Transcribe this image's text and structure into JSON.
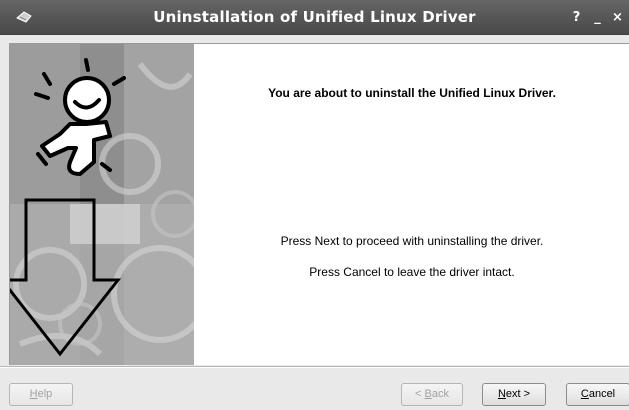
{
  "window": {
    "title": "Uninstallation of Unified Linux Driver",
    "title_buttons": {
      "help": "?",
      "minimize": "_",
      "close": "×"
    }
  },
  "main": {
    "heading": "You are about to uninstall the Unified Linux Driver.",
    "line1": "Press Next to proceed with uninstalling the driver.",
    "line2": "Press Cancel to leave the driver intact."
  },
  "buttons": {
    "help": {
      "mnemonic": "H",
      "rest": "elp",
      "enabled": false
    },
    "back": {
      "prefix": "< ",
      "mnemonic": "B",
      "rest": "ack",
      "enabled": false
    },
    "next": {
      "mnemonic": "N",
      "rest": "ext >",
      "enabled": true
    },
    "cancel": {
      "mnemonic": "C",
      "rest": "ancel",
      "enabled": true
    }
  },
  "icons": {
    "app": "app-icon",
    "side_figure": "jumping-figure-icon",
    "side_arrow": "down-arrow-icon"
  },
  "colors": {
    "titlebar": "#545454",
    "panel_gray": "#a8a8a8",
    "content_bg": "#ffffff"
  }
}
